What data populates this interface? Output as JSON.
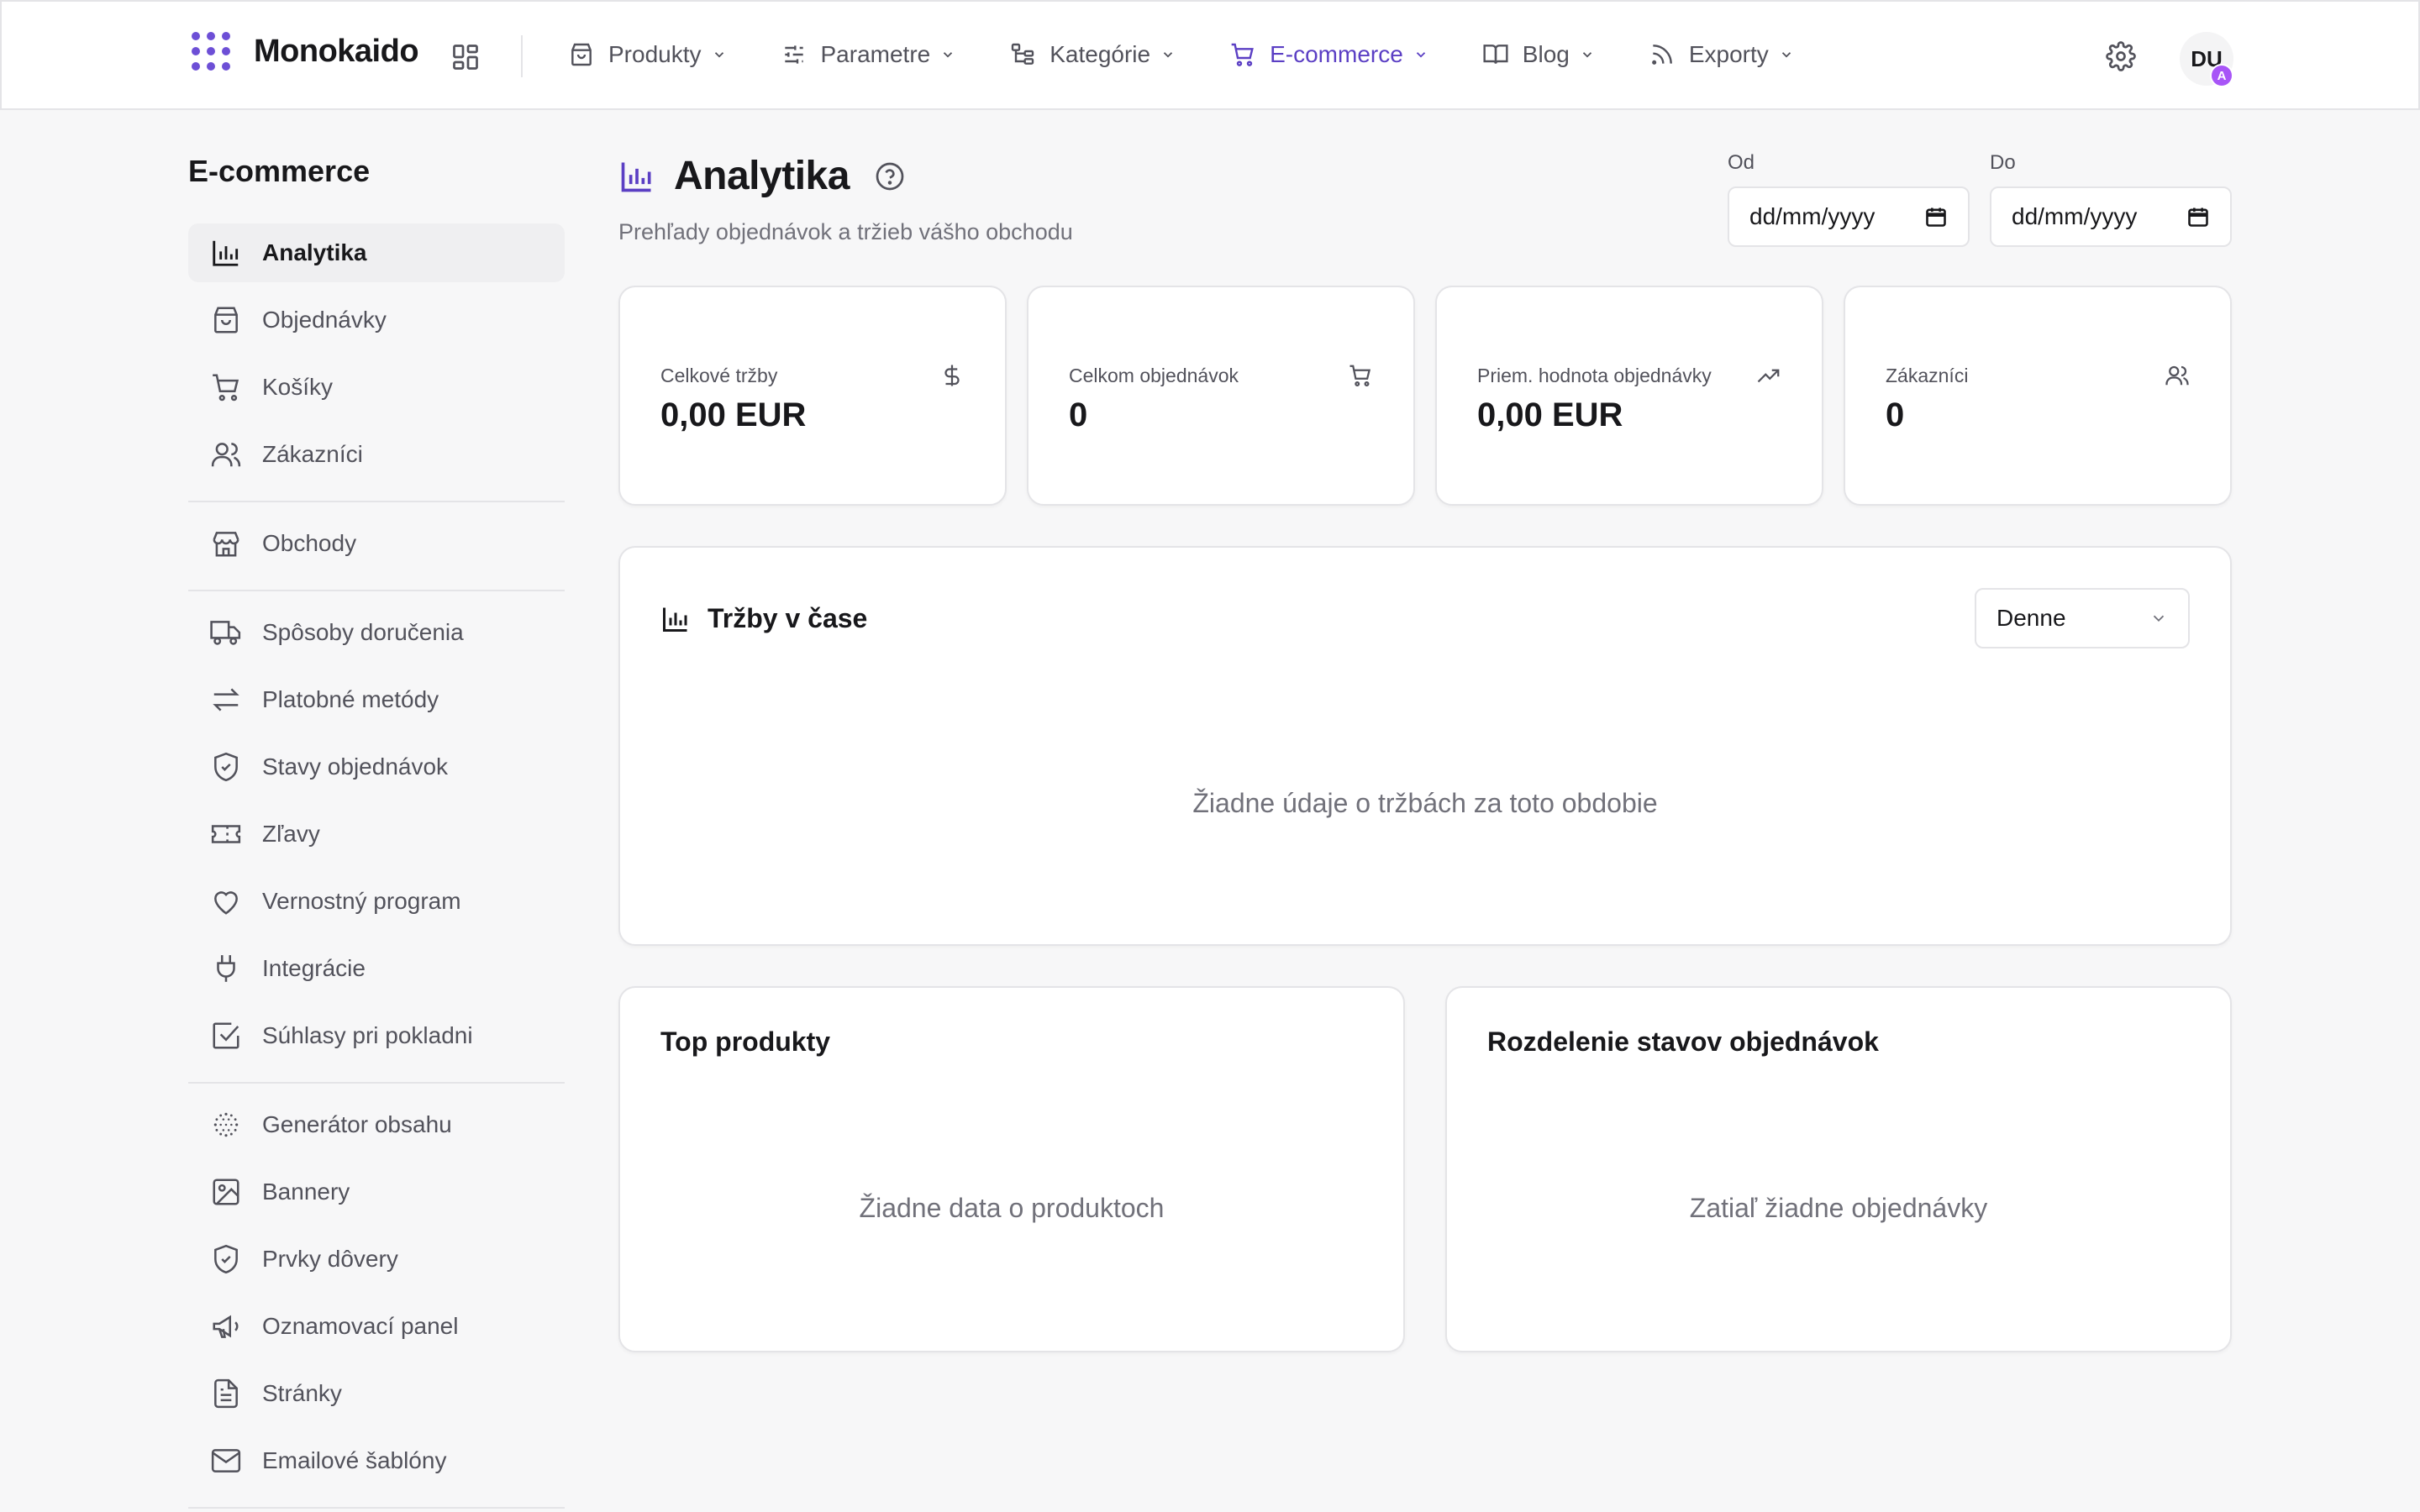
{
  "brand": {
    "name": "Monokaido",
    "accent": "#5b3fc4"
  },
  "nav": {
    "items": [
      {
        "label": "Produkty",
        "icon": "shopping-bag-icon"
      },
      {
        "label": "Parametre",
        "icon": "sliders-icon"
      },
      {
        "label": "Kategórie",
        "icon": "tree-icon"
      },
      {
        "label": "E-commerce",
        "icon": "cart-icon",
        "active": true
      },
      {
        "label": "Blog",
        "icon": "book-icon"
      },
      {
        "label": "Exporty",
        "icon": "rss-icon"
      }
    ]
  },
  "user": {
    "initials": "DU",
    "badge": "A"
  },
  "sidebar": {
    "title": "E-commerce",
    "items": [
      {
        "label": "Analytika",
        "icon": "bar-chart-icon",
        "active": true
      },
      {
        "label": "Objednávky",
        "icon": "shopping-bag-icon"
      },
      {
        "label": "Košíky",
        "icon": "cart-icon"
      },
      {
        "label": "Zákazníci",
        "icon": "users-icon"
      },
      {
        "label": "Obchody",
        "icon": "store-icon"
      },
      {
        "label": "Spôsoby doručenia",
        "icon": "truck-icon"
      },
      {
        "label": "Platobné metódy",
        "icon": "arrows-icon"
      },
      {
        "label": "Stavy objednávok",
        "icon": "shield-check-icon"
      },
      {
        "label": "Zľavy",
        "icon": "ticket-icon"
      },
      {
        "label": "Vernostný program",
        "icon": "heart-icon"
      },
      {
        "label": "Integrácie",
        "icon": "plug-icon"
      },
      {
        "label": "Súhlasy pri pokladni",
        "icon": "checkbox-icon"
      },
      {
        "label": "Generátor obsahu",
        "icon": "sparkle-dots-icon"
      },
      {
        "label": "Bannery",
        "icon": "image-icon"
      },
      {
        "label": "Prvky dôvery",
        "icon": "shield-check-icon"
      },
      {
        "label": "Oznamovací panel",
        "icon": "megaphone-icon"
      },
      {
        "label": "Stránky",
        "icon": "file-text-icon"
      },
      {
        "label": "Emailové šablóny",
        "icon": "mail-icon"
      }
    ]
  },
  "header": {
    "title": "Analytika",
    "subtitle": "Prehľady objednávok a tržieb vášho obchodu",
    "date_from": {
      "label": "Od",
      "value": "dd/mm/yyyy"
    },
    "date_to": {
      "label": "Do",
      "value": "dd/mm/yyyy"
    }
  },
  "stats": [
    {
      "label": "Celkové tržby",
      "value": "0,00 EUR",
      "icon": "dollar-icon"
    },
    {
      "label": "Celkom objednávok",
      "value": "0",
      "icon": "cart-icon"
    },
    {
      "label": "Priem. hodnota objednávky",
      "value": "0,00 EUR",
      "icon": "trending-up-icon"
    },
    {
      "label": "Zákazníci",
      "value": "0",
      "icon": "users-icon"
    }
  ],
  "revenue_chart": {
    "title": "Tržby v čase",
    "period": "Denne",
    "empty": "Žiadne údaje o tržbách za toto obdobie"
  },
  "top_products": {
    "title": "Top produkty",
    "empty": "Žiadne data o produktoch"
  },
  "order_status": {
    "title": "Rozdelenie stavov objednávok",
    "empty": "Zatiaľ žiadne objednávky"
  }
}
